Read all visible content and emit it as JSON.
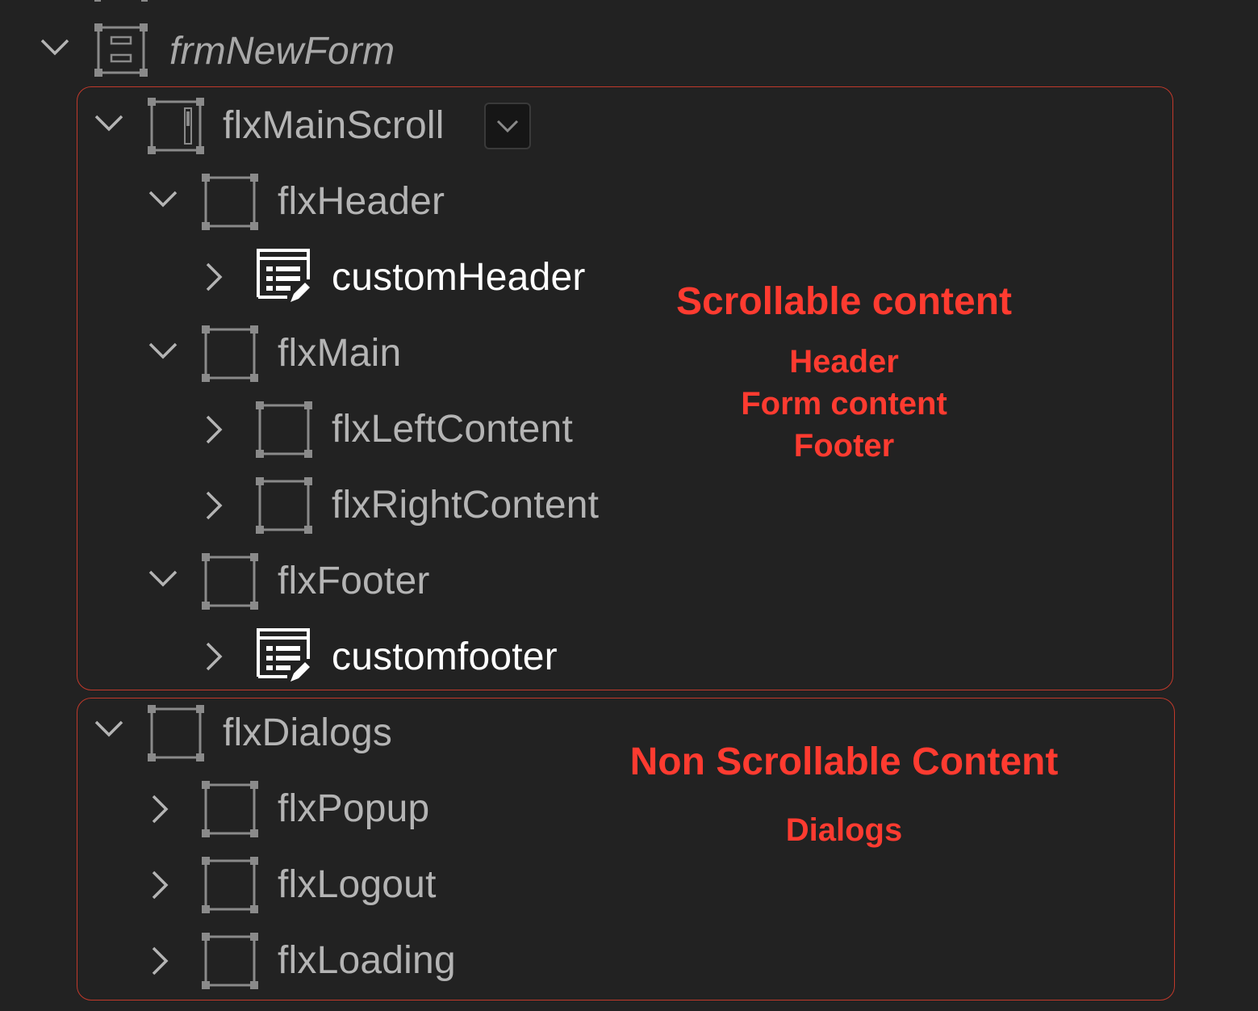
{
  "tree": {
    "root": {
      "label": "frmNewForm",
      "icon": "form-icon",
      "expanded": true
    },
    "scroll": {
      "label": "flxMainScroll",
      "icon": "scroll-flex-icon",
      "expanded": true,
      "dropdown_icon": "chevron-down-icon",
      "children": {
        "header": {
          "label": "flxHeader",
          "icon": "flex-container-icon",
          "expanded": true,
          "child": {
            "label": "customHeader",
            "icon": "component-edit-icon",
            "expanded": false
          }
        },
        "main": {
          "label": "flxMain",
          "icon": "flex-container-icon",
          "expanded": true,
          "left": {
            "label": "flxLeftContent",
            "icon": "flex-container-icon",
            "expanded": false
          },
          "right": {
            "label": "flxRightContent",
            "icon": "flex-container-icon",
            "expanded": false
          }
        },
        "footer": {
          "label": "flxFooter",
          "icon": "flex-container-icon",
          "expanded": true,
          "child": {
            "label": "customfooter",
            "icon": "component-edit-icon",
            "expanded": false
          }
        }
      }
    },
    "dialogs": {
      "label": "flxDialogs",
      "icon": "flex-container-icon",
      "expanded": true,
      "popup": {
        "label": "flxPopup",
        "expanded": false
      },
      "logout": {
        "label": "flxLogout",
        "expanded": false
      },
      "loading": {
        "label": "flxLoading",
        "expanded": false
      }
    }
  },
  "annotations": {
    "scrollable": {
      "title": "Scrollable content",
      "line1": "Header",
      "line2": "Form content",
      "line3": "Footer"
    },
    "non_scrollable": {
      "title": "Non Scrollable Content",
      "line1": "Dialogs"
    }
  },
  "colors": {
    "background": "#222222",
    "label": "#b4b4b4",
    "label_highlight": "#ffffff",
    "annotation": "#ff3b30",
    "region_border": "#c0392b"
  }
}
